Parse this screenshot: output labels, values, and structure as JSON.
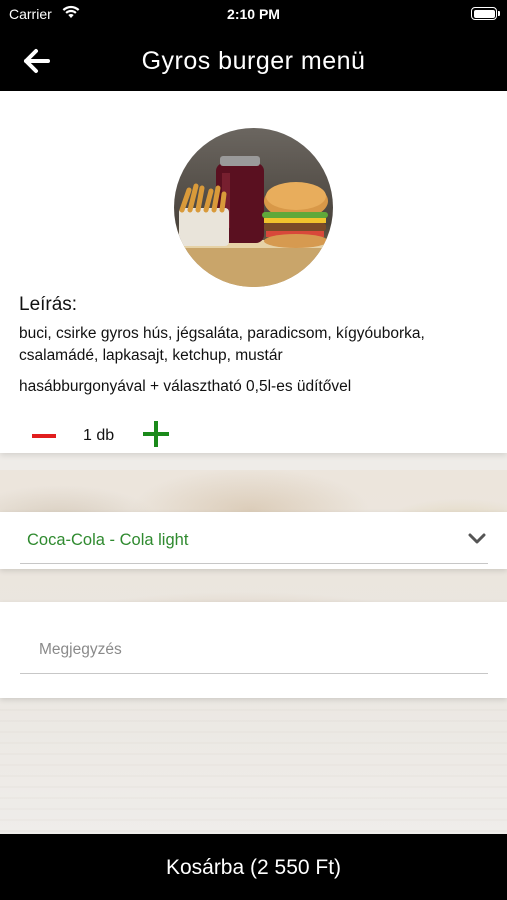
{
  "status_bar": {
    "carrier": "Carrier",
    "time": "2:10 PM"
  },
  "nav": {
    "title": "Gyros burger menü",
    "back_icon": "arrow-left-icon"
  },
  "product": {
    "image_icon": "burger-fries-drink-photo",
    "description_title": "Leírás:",
    "description": "buci, csirke gyros hús, jégsaláta, paradicsom, kígyóuborka, csalamádé, lapkasajt, ketchup, mustár",
    "extra": "hasábburgonyával + választható 0,5l-es üdítővel",
    "quantity_label": "1 db"
  },
  "drink_select": {
    "selected": "Coca-Cola - Cola light",
    "icon": "chevron-down-icon"
  },
  "note": {
    "placeholder": "Megjegyzés"
  },
  "cart_button": {
    "label": "Kosárba (2 550 Ft)"
  },
  "colors": {
    "minus": "#e11d1d",
    "plus": "#1a8a1a",
    "drink_text": "#2f8a2f",
    "bars": "#000000"
  }
}
